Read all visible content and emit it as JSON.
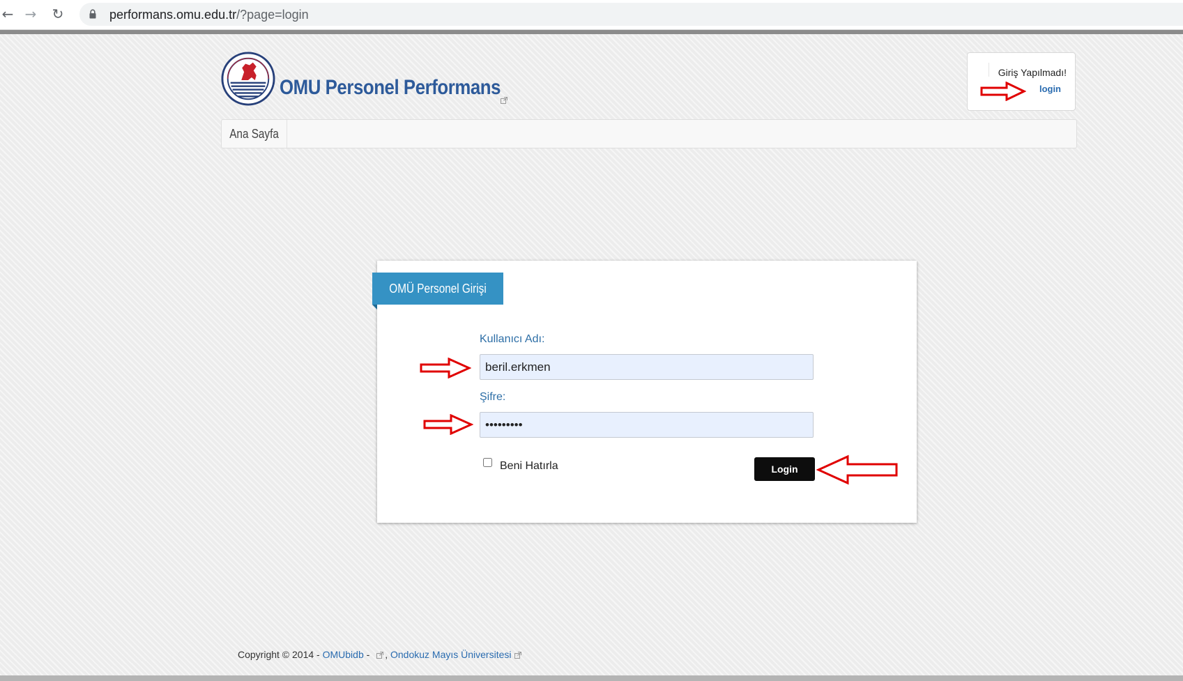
{
  "browser": {
    "url_domain": "performans.omu.edu.tr",
    "url_path": "/?page=login",
    "back_icon": "arrow-left-icon",
    "forward_icon": "arrow-right-icon",
    "reload_icon": "reload-icon",
    "lock_icon": "lock-icon"
  },
  "header": {
    "site_title": "OMU Personel Performans",
    "status_text": "Giriş Yapılmadı!",
    "login_link": "login"
  },
  "nav": {
    "items": [
      {
        "label": "Ana Sayfa"
      }
    ]
  },
  "login_form": {
    "panel_title": "OMÜ Personel Girişi",
    "username_label": "Kullanıcı Adı:",
    "username_value": "beril.erkmen",
    "password_label": "Şifre:",
    "password_value": "ABCDEFGHI",
    "remember_label": "Beni Hatırla",
    "remember_checked": false,
    "submit_label": "Login"
  },
  "footer": {
    "prefix": "Copyright © 2014 - ",
    "link1": "OMUbidb",
    "sep1": " - ",
    "sep2": ",",
    "link2": "Ondokuz Mayıs Üniversitesi"
  },
  "colors": {
    "title_blue": "#2d5a9a",
    "ribbon_blue": "#3592c4",
    "label_blue": "#2d6ea6",
    "annotation_red": "#e00000",
    "button_black": "#0d0d0d"
  }
}
